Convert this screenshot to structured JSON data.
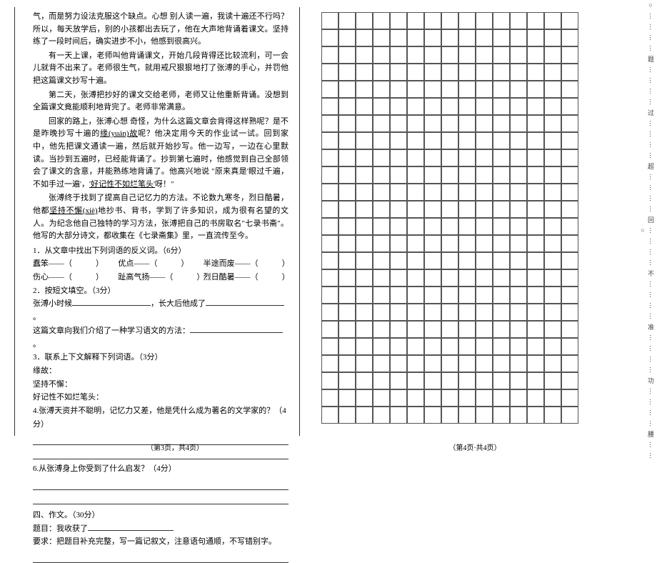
{
  "left": {
    "para1": "气，而是努力设法克服这个缺点。心想 别人读一遍，我读十遍还不行吗？所以，每天放学后，别的小孩都出去玩了，他在大声地背诵着课文。坚持练了一段时间后，确实进步不小，他感到很高兴。",
    "para2": "有一天上课，老师叫他背诵课文，开始几段背得还比较流利，可一会儿就背不出来了。老师很生气，就用戒尺狠狠地打了张溥的手心，并罚他把这篇课文抄写十遍。",
    "para3": "第二天，张溥把抄好的课文交给老师，老师又让他重新背诵。没想到全篇课文竟能顺利地背完了。老师非常满意。",
    "para4_a": "回家的路上，张溥心想 奇怪，为什么这篇文章会背得这样熟呢？是不是昨晚抄写十遍的",
    "para4_b": "缘(yuán)故",
    "para4_c": "呢？他决定用今天的作业试一试。回到家中，他先把课文通读一遍，然后就开始抄写。他一边写，一边在心里默读。当抄到五遍时，已经能背诵了。抄到第七遍时，他感觉到自己全部领会了课文的含意，并能熟练地背诵了。他高兴地说 \"原来真是'眼过千遍，不如手过一遍'，",
    "para4_d": "'好记性不如烂笔头'",
    "para4_e": "呀！\"",
    "para5_a": "张溥终于找到了提高自己记忆力的方法。不论数九寒冬，烈日酷暑，他都",
    "para5_b": "坚持不懈(xiè)",
    "para5_c": "地抄书、背书，学到了许多知识，成为很有名望的文人。为纪念他自己独特的学习方法，张溥把自己的书房取名\"七录书斋\"。他写的大部分诗文，都收集在《七录斋集》里，一直流传至今。",
    "q1": "1．从文章中找出下列词语的反义词。（6分）",
    "q1r1a": "蠢笨——（　　　）",
    "q1r1b": "优点——（　　　）",
    "q1r1c": "半途而废——（　　　）",
    "q1r2a": "伤心——（　　　）",
    "q1r2b": "趾高气扬——（　　　）",
    "q1r2c": "烈日酷暑——（　　　）",
    "q2": "2．按短文填空。（3分）",
    "q2a": "张溥小时候",
    "q2b": "，长大后他成了",
    "q2c": "。",
    "q2d": "这篇文章向我们介绍了一种学习语文的方法：",
    "q2e": "。",
    "q3": "3．联系上下文解释下列词语。（3分）",
    "q3a": "缘故：",
    "q3b": "坚持不懈：",
    "q3c": "好记性不如烂笔头：",
    "q4": "4.张溥天资并不聪明，记忆力又差，他是凭什么成为著名的文学家的？（4分）",
    "q6": "6.从张溥身上你受到了什么启发？（4分）",
    "sec4": "四、作文。（30分）",
    "topic": "题目：我收获了",
    "req": "要求：把题目补充完整，写一篇记叙文，注意语句通顺，不写错别字。",
    "pagenum": "（第3页，共4页）"
  },
  "right": {
    "pagenum": "（第4页·共4页）"
  },
  "binding": "○⋯⋯⋯⋯题⋯⋯⋯⋯过⋯⋯⋯⋯超⋯⋯⋯⋯回⋯⋯⋯⋯不⋯⋯⋯⋯准⋯⋯⋯⋯功⋯⋯⋯⋯腰⋯⋯○"
}
